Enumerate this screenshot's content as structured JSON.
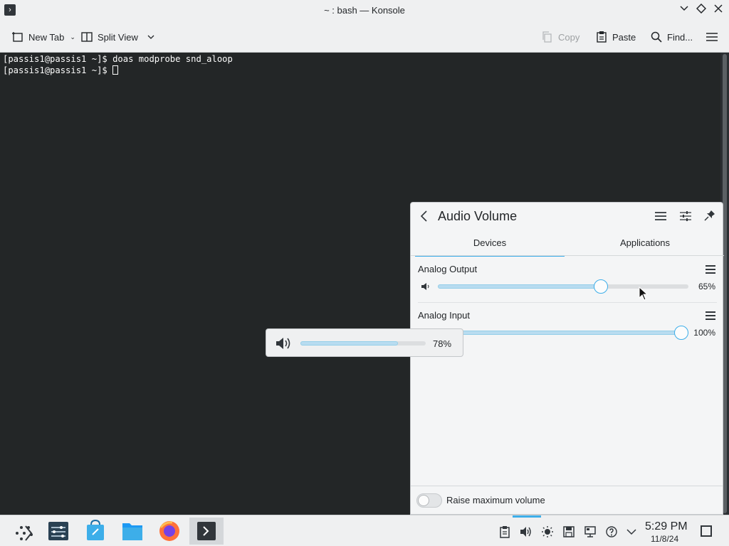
{
  "window": {
    "title": "~ : bash — Konsole",
    "controls": [
      "minimize",
      "maximize",
      "close"
    ]
  },
  "toolbar": {
    "new_tab": "New Tab",
    "split_view": "Split View",
    "copy": "Copy",
    "paste": "Paste",
    "find": "Find..."
  },
  "terminal": {
    "lines": [
      "[passis1@passis1 ~]$ doas modprobe snd_aloop",
      "[passis1@passis1 ~]$ "
    ]
  },
  "audio": {
    "title": "Audio Volume",
    "tabs": [
      "Devices",
      "Applications"
    ],
    "active_tab": "Devices",
    "devices": [
      {
        "label": "Analog Output",
        "percent_text": "65%",
        "level": 0.65
      },
      {
        "label": "Analog Input",
        "percent_text": "100%",
        "level": 1.0
      }
    ],
    "raise_max": "Raise maximum volume",
    "raise_max_enabled": false
  },
  "osd": {
    "percent_text": "78%",
    "level": 0.78
  },
  "taskbar": {
    "time": "5:29 PM",
    "date": "11/8/24",
    "apps": [
      "application-launcher",
      "system-settings",
      "discover",
      "dolphin",
      "firefox",
      "konsole"
    ],
    "active_app": "konsole"
  },
  "colors": {
    "accent": "#3daee9",
    "terminal_bg": "#232627",
    "panel_bg": "#eff0f1"
  }
}
